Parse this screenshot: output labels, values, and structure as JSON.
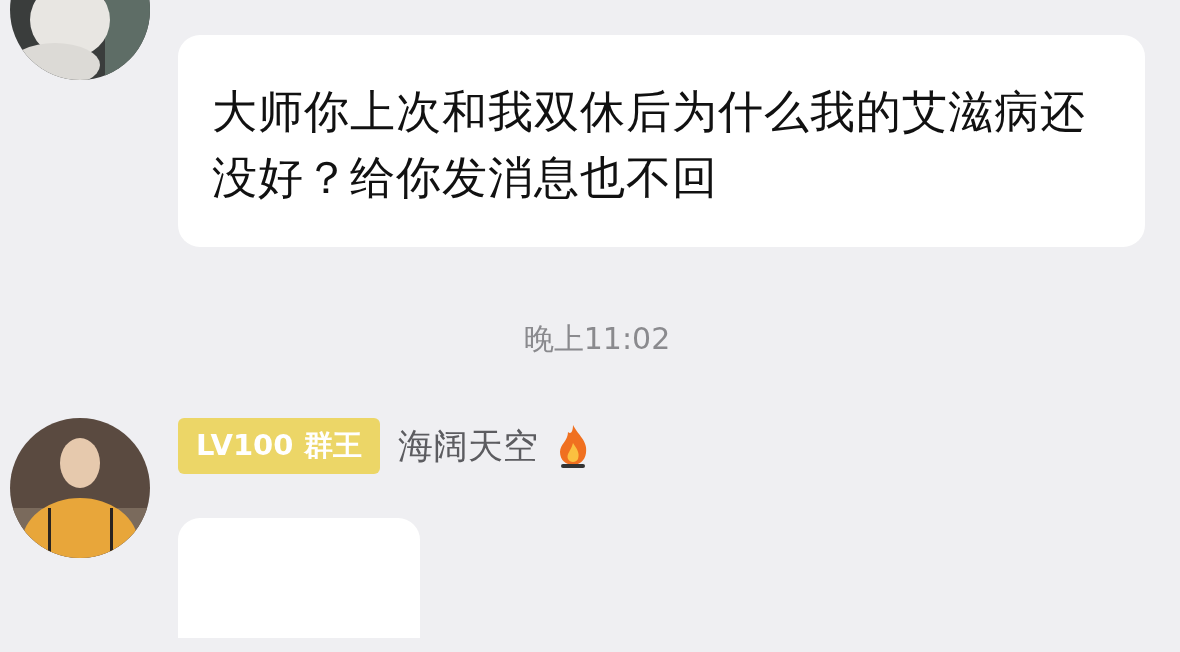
{
  "messages": [
    {
      "kind": "text",
      "text": "大师你上次和我双休后为什么我的艾滋病还没好？给你发消息也不回"
    },
    {
      "kind": "time",
      "text": "晚上11:02"
    },
    {
      "kind": "sender",
      "badge": "LV100 群王",
      "name": "海阔天空"
    }
  ]
}
